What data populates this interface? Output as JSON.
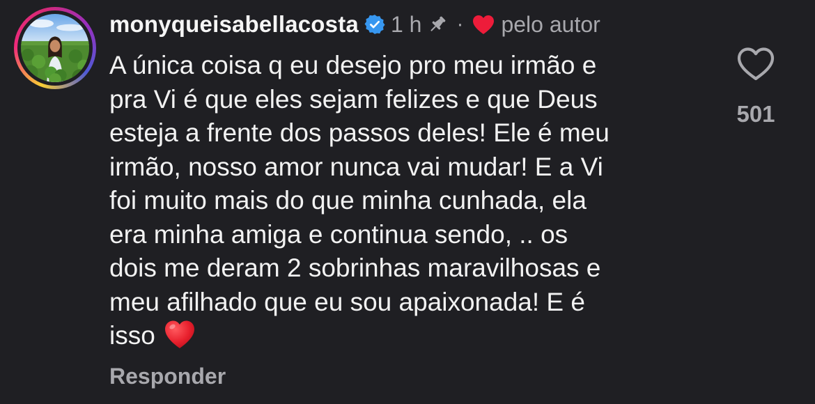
{
  "comment": {
    "username": "monyqueisabellacosta",
    "verified": true,
    "time": "1 h",
    "separator": "·",
    "liked_by_author_label": "pelo autor",
    "text": "A única coisa q eu desejo pro meu irmão e\npra Vi é que eles sejam felizes e que Deus\nesteja a frente dos passos deles! Ele é meu\nirmão, nosso amor nunca vai mudar! E a Vi\nfoi muito mais do que minha cunhada, ela\nera minha amiga e continua sendo, .. os\ndois me deram 2 sobrinhas maravilhosas e\nmeu afilhado que eu sou apaixonada! E é\nisso",
    "trailing_emoji": "red-heart",
    "reply_label": "Responder",
    "like_count": "501"
  },
  "icons": {
    "verified": "verified-badge-icon",
    "pin": "pin-icon",
    "liked_by_author": "heart-filled-icon",
    "like": "heart-outline-icon"
  },
  "colors": {
    "background": "#1f1f23",
    "text_primary": "#f5f5f5",
    "text_secondary": "#a8a8ad",
    "verified_blue": "#3797f0",
    "heart_red": "#ed1c3a"
  }
}
